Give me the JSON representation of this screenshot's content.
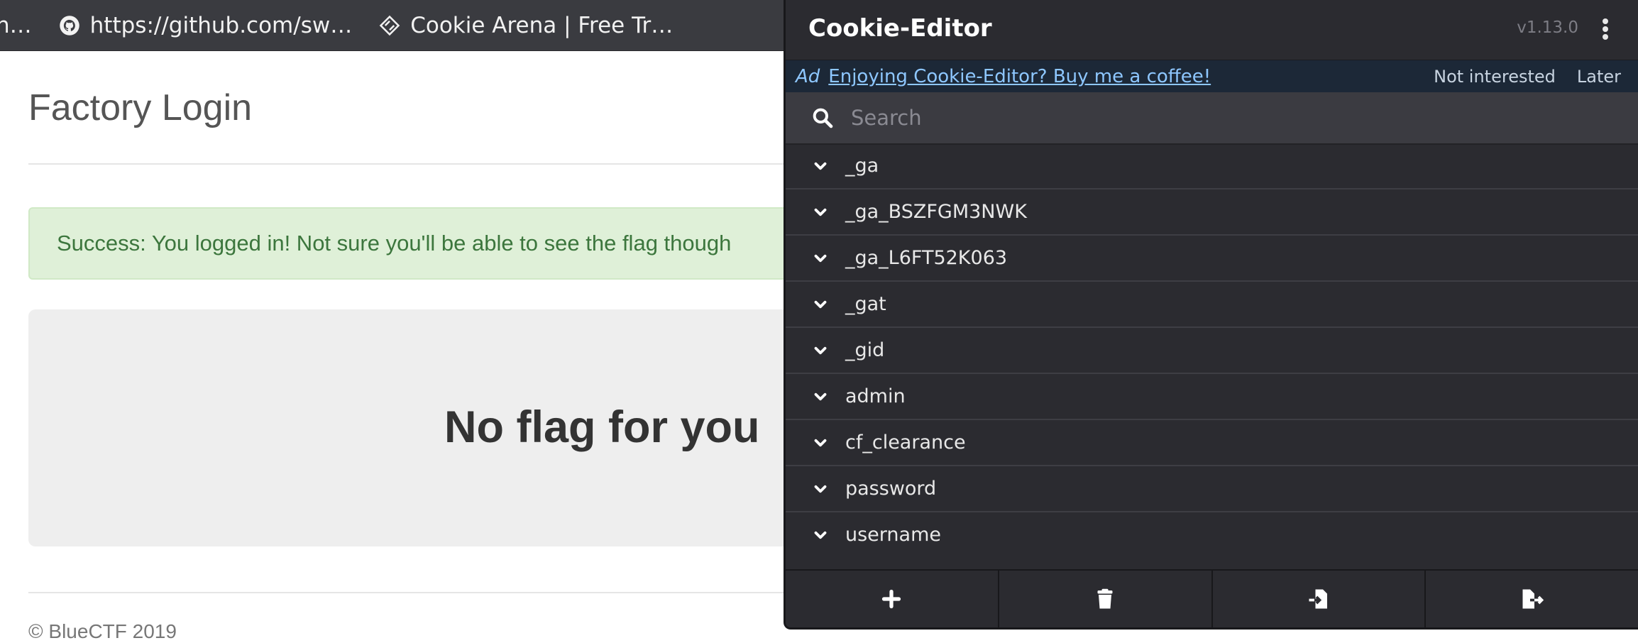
{
  "bookmarks": [
    {
      "label": "n…",
      "icon": "globe-icon"
    },
    {
      "label": "https://github.com/sw…",
      "icon": "github-icon"
    },
    {
      "label": "Cookie Arena | Free Tr…",
      "icon": "cookie-arena-icon"
    }
  ],
  "page": {
    "title": "Factory Login",
    "alert": "Success: You logged in! Not sure you'll be able to see the flag though",
    "message": "No flag for you",
    "footer": "© BlueCTF 2019"
  },
  "cookie_editor": {
    "title": "Cookie-Editor",
    "version": "v1.13.0",
    "ad": {
      "tag": "Ad",
      "link": "Enjoying Cookie-Editor? Buy me a coffee!",
      "not_interested": "Not interested",
      "later": "Later"
    },
    "search": {
      "placeholder": "Search",
      "value": ""
    },
    "cookies": [
      "_ga",
      "_ga_BSZFGM3NWK",
      "_ga_L6FT52K063",
      "_gat",
      "_gid",
      "admin",
      "cf_clearance",
      "password",
      "username"
    ],
    "footer_buttons": [
      "add-cookie-button",
      "delete-all-button",
      "import-button",
      "export-button"
    ]
  },
  "colors": {
    "popup_bg": "#2b2b30",
    "ad_bg": "#1c2837",
    "link": "#8ec7ff",
    "alert_bg": "#dff0d8",
    "alert_text": "#3c763d"
  }
}
